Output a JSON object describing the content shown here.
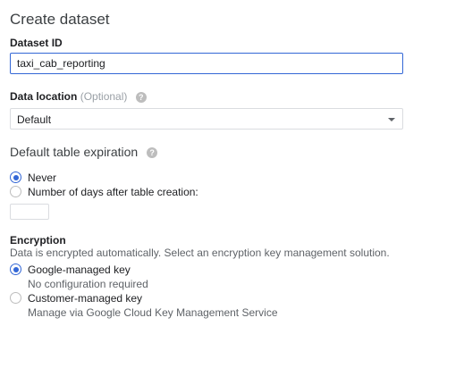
{
  "page": {
    "title": "Create dataset"
  },
  "dataset_id": {
    "label": "Dataset ID",
    "value": "taxi_cab_reporting"
  },
  "data_location": {
    "label": "Data location",
    "optional": "(Optional)",
    "selected": "Default",
    "help_icon": "help-icon"
  },
  "expiration": {
    "heading": "Default table expiration",
    "help_icon": "help-icon",
    "options": [
      {
        "label": "Never",
        "checked": true
      },
      {
        "label": "Number of days after table creation:",
        "checked": false
      }
    ],
    "days_value": ""
  },
  "encryption": {
    "heading": "Encryption",
    "description": "Data is encrypted automatically. Select an encryption key management solution.",
    "options": [
      {
        "label": "Google-managed key",
        "sublabel": "No configuration required",
        "checked": true
      },
      {
        "label": "Customer-managed key",
        "sublabel": "Manage via Google Cloud Key Management Service",
        "checked": false
      }
    ]
  },
  "colors": {
    "accent": "#3367d6",
    "text": "#202124",
    "muted": "#5f6368",
    "optional": "#9aa0a6",
    "border": "#dadce0"
  }
}
